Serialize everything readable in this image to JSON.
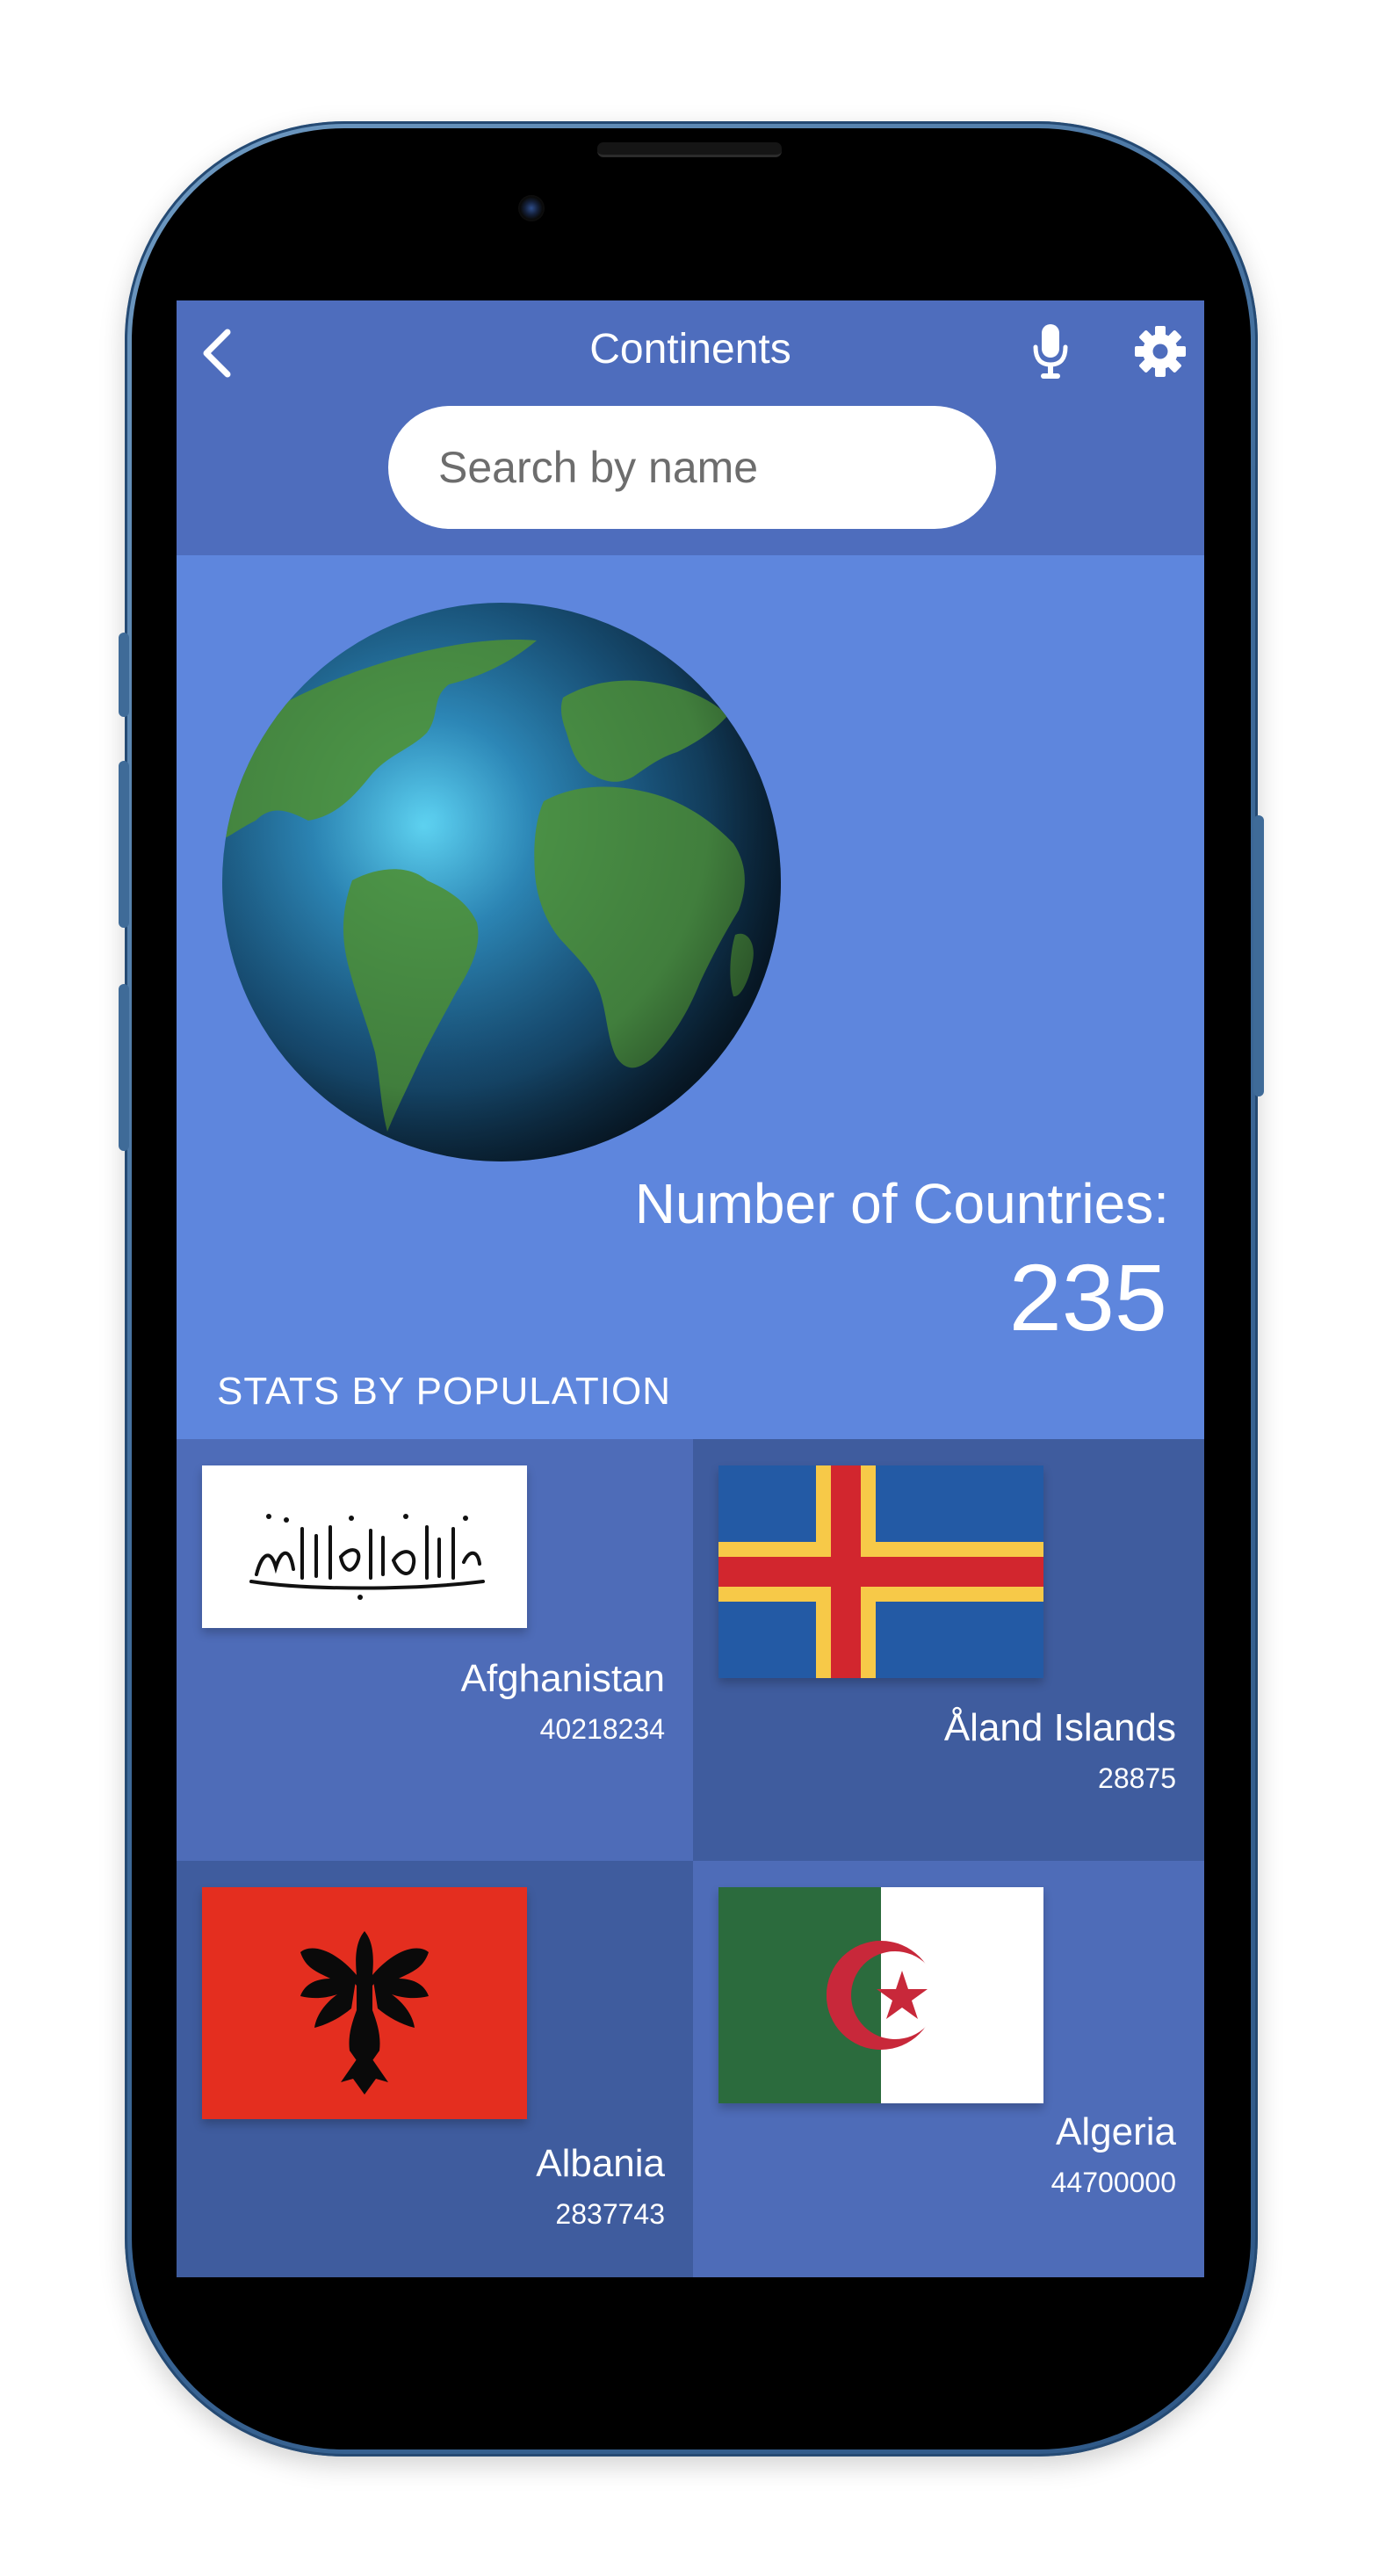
{
  "header": {
    "title": "Continents",
    "back_icon": "chevron-left-icon",
    "mic_icon": "microphone-icon",
    "settings_icon": "gear-icon"
  },
  "search": {
    "placeholder": "Search by name",
    "value": ""
  },
  "summary": {
    "countries_label": "Number of Countries:",
    "countries_count": "235"
  },
  "stats": {
    "section_title": "STATS BY POPULATION",
    "countries": [
      {
        "name": "Afghanistan",
        "population": "40218234",
        "flag": "afghanistan-flag"
      },
      {
        "name": "Åland Islands",
        "population": "28875",
        "flag": "aland-islands-flag"
      },
      {
        "name": "Albania",
        "population": "2837743",
        "flag": "albania-flag"
      },
      {
        "name": "Algeria",
        "population": "44700000",
        "flag": "algeria-flag"
      }
    ]
  },
  "colors": {
    "header_bg": "#4e6dbd",
    "screen_bg": "#5e86dd",
    "card_light": "#4e6cb8",
    "card_dark": "#3f5c9e",
    "phone_frame": "#3e6a99"
  }
}
